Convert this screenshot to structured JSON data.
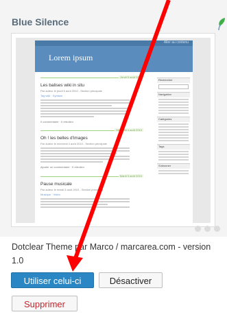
{
  "theme": {
    "name": "Blue Silence",
    "description": "Dotclear Theme par Marco / marcarea.com - version 1.0"
  },
  "preview": {
    "site_title": "Lorem ipsum",
    "top_links": "Aller au contenu",
    "posts": [
      {
        "date": "Jeudi 5 août 2010",
        "title": "Les balises wiki in situ",
        "meta": "Par auteur le jeudi 5 août 2010 - Section principale",
        "tags": "Tag wiki · Syntaxe",
        "footer": "0 commentaire · 0 rétrolien"
      },
      {
        "date": "Mercredi 4 août 2010",
        "title": "Oh ! les belles d'images",
        "meta": "Par auteur le mercredi 4 août 2010 - Section principale",
        "tags": "",
        "footer": "Ajouter un commentaire · 0 rétrolien"
      },
      {
        "date": "Mardi 3 août 2010",
        "title": "Pause musicale",
        "meta": "Par auteur le mardi 3 août 2010 - Section principale",
        "tags": "Musique · Vidéo",
        "footer": ""
      }
    ],
    "sidebar_headings": [
      "Rechercher",
      "Navigation",
      "Catégories",
      "Tags",
      "S'abonner"
    ]
  },
  "buttons": {
    "activate": "Utiliser celui-ci",
    "deactivate": "Désactiver",
    "delete": "Supprimer"
  },
  "colors": {
    "primary_button": "#2b87c4",
    "danger_text": "#c0262d",
    "arrow": "#ff0000",
    "leaf": "#3fae49"
  }
}
